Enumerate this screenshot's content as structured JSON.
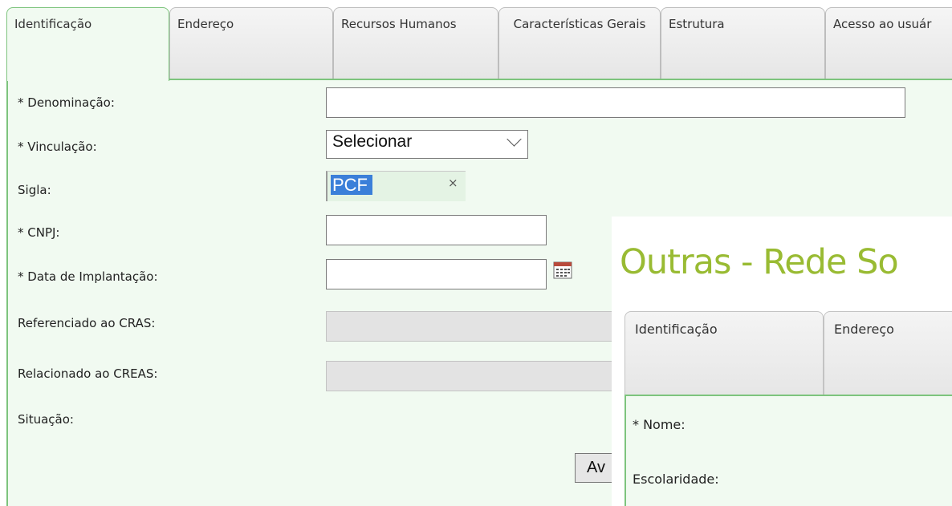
{
  "tabs": [
    {
      "label": "Identificação",
      "active": true
    },
    {
      "label": "Endereço",
      "active": false
    },
    {
      "label": "Recursos Humanos",
      "active": false
    },
    {
      "label": "Características Gerais",
      "active": false
    },
    {
      "label": "Estrutura",
      "active": false
    },
    {
      "label": "Acesso ao usuár",
      "active": false
    }
  ],
  "form": {
    "denominacao_label": "* Denominação:",
    "denominacao_value": "",
    "vinculacao_label": "* Vinculação:",
    "vinculacao_selected": "Selecionar",
    "sigla_label": "Sigla:",
    "sigla_value": "PCF",
    "sigla_clear": "×",
    "cnpj_label": "* CNPJ:",
    "cnpj_value": "",
    "data_label": "* Data de Implantação:",
    "data_value": "",
    "cras_label": "Referenciado ao CRAS:",
    "creas_label": "Relacionado ao CREAS:",
    "situacao_label": "Situação:",
    "button_label": "Av"
  },
  "icons": {
    "calendar": "calendar-icon",
    "dropdown": "chevron-down-icon",
    "clear": "close-icon"
  },
  "overlay": {
    "title": "Outras - Rede So",
    "tabs": [
      {
        "label": "Identificação"
      },
      {
        "label": "Endereço"
      }
    ],
    "nome_label": "* Nome:",
    "escolaridade_label": "Escolaridade:"
  },
  "colors": {
    "accent_green": "#7dc47d",
    "panel_bg": "#f1faf1",
    "title_green": "#99bb33",
    "selection_blue": "#3b7fd9"
  }
}
